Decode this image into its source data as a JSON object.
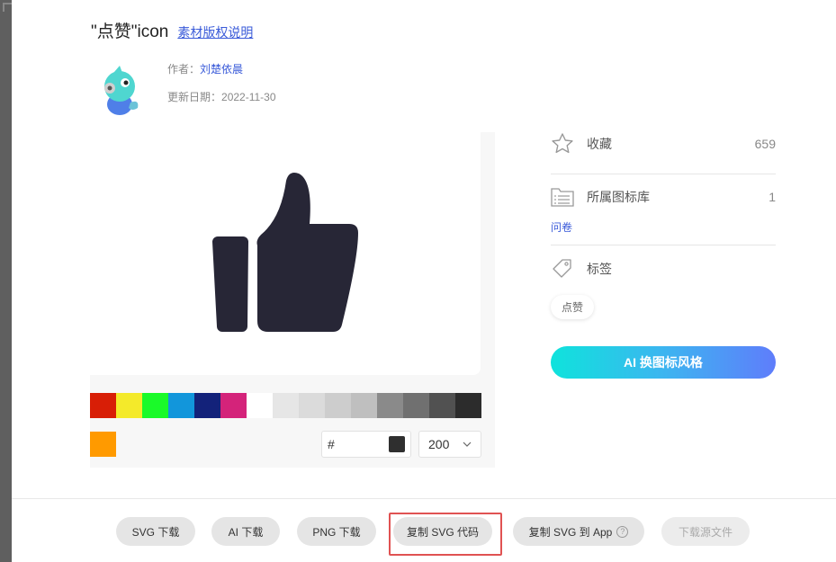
{
  "header": {
    "title": "\"点赞\"icon",
    "copyright_link": "素材版权说明"
  },
  "author": {
    "label": "作者：",
    "name": "刘楚依晨",
    "date_label": "更新日期：",
    "date": "2022-11-30"
  },
  "preview": {
    "icon": "thumbs-up-icon",
    "icon_color": "#272636",
    "swatches": [
      "#d81e06",
      "#f4ea2a",
      "#1afa29",
      "#1296db",
      "#13227a",
      "#d4237a",
      "#ffffff",
      "#e6e6e6",
      "#dbdbdb",
      "#cdcdcd",
      "#bfbfbf",
      "#8a8a8a",
      "#707070",
      "#515151",
      "#2c2c2c"
    ],
    "extra_swatch": "#ff9a00",
    "hex_prefix": "#",
    "hex_value": "",
    "hex_color": "#2f2f2f",
    "size": "200"
  },
  "side": {
    "favorites_label": "收藏",
    "favorites_count": "659",
    "library_label": "所属图标库",
    "library_count": "1",
    "library_name": "问卷",
    "tags_label": "标签",
    "tag": "点赞",
    "ai_button": "AI 换图标风格"
  },
  "footer": {
    "svg_download": "SVG 下载",
    "ai_download": "AI 下载",
    "png_download": "PNG 下载",
    "copy_svg": "复制 SVG 代码",
    "copy_svg_app": "复制 SVG 到 App",
    "help": "?",
    "download_source": "下载源文件"
  }
}
